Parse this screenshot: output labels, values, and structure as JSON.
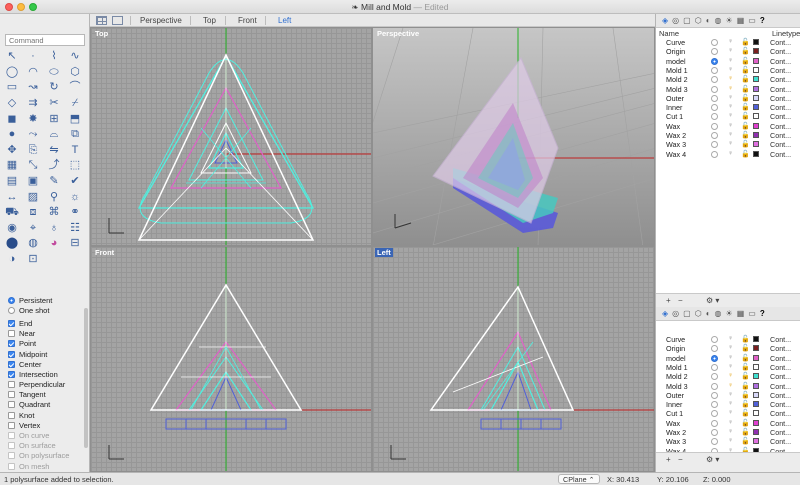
{
  "window": {
    "title": "Mill and Mold",
    "edited": "— Edited"
  },
  "viewport_tabs": [
    "Perspective",
    "Top",
    "Front",
    "Left"
  ],
  "command": {
    "placeholder": "Command"
  },
  "osnap": {
    "modes": [
      {
        "label": "Persistent",
        "selected": true
      },
      {
        "label": "One shot",
        "selected": false
      }
    ],
    "items": [
      {
        "label": "End",
        "checked": true,
        "enabled": true
      },
      {
        "label": "Near",
        "checked": false,
        "enabled": true
      },
      {
        "label": "Point",
        "checked": true,
        "enabled": true
      },
      {
        "label": "Midpoint",
        "checked": true,
        "enabled": true
      },
      {
        "label": "Center",
        "checked": true,
        "enabled": true
      },
      {
        "label": "Intersection",
        "checked": true,
        "enabled": true
      },
      {
        "label": "Perpendicular",
        "checked": false,
        "enabled": true
      },
      {
        "label": "Tangent",
        "checked": false,
        "enabled": true
      },
      {
        "label": "Quadrant",
        "checked": false,
        "enabled": true
      },
      {
        "label": "Knot",
        "checked": false,
        "enabled": true
      },
      {
        "label": "Vertex",
        "checked": false,
        "enabled": true
      },
      {
        "label": "On curve",
        "checked": false,
        "enabled": false
      },
      {
        "label": "On surface",
        "checked": false,
        "enabled": false
      },
      {
        "label": "On polysurface",
        "checked": false,
        "enabled": false
      },
      {
        "label": "On mesh",
        "checked": false,
        "enabled": false
      }
    ]
  },
  "viewports": {
    "top": {
      "label": "Top",
      "active": false
    },
    "perspective": {
      "label": "Perspective",
      "active": false
    },
    "front": {
      "label": "Front",
      "active": false
    },
    "left": {
      "label": "Left",
      "active": true
    }
  },
  "layers": {
    "header": {
      "name": "Name",
      "linetype": "Linetype"
    },
    "rows": [
      {
        "name": "Curve",
        "color": "#111111",
        "current": false,
        "on": false,
        "linetype": "Cont..."
      },
      {
        "name": "Origin",
        "color": "#7a1f1f",
        "current": false,
        "on": false,
        "linetype": "Cont..."
      },
      {
        "name": "model",
        "color": "#e060c8",
        "current": true,
        "on": false,
        "linetype": "Cont..."
      },
      {
        "name": "Mold 1",
        "color": "#ffffff",
        "current": false,
        "on": false,
        "linetype": "Cont..."
      },
      {
        "name": "Mold 2",
        "color": "#40e0d0",
        "current": false,
        "on": true,
        "linetype": "Cont..."
      },
      {
        "name": "Mold 3",
        "color": "#b070e0",
        "current": false,
        "on": true,
        "linetype": "Cont..."
      },
      {
        "name": "Outer",
        "color": "#d8d8f8",
        "current": false,
        "on": false,
        "linetype": "Cont..."
      },
      {
        "name": "Inner",
        "color": "#5060d8",
        "current": false,
        "on": false,
        "linetype": "Cont..."
      },
      {
        "name": "Cut 1",
        "color": "#ffffff",
        "current": false,
        "on": false,
        "linetype": "Cont..."
      },
      {
        "name": "Wax",
        "color": "#e040d0",
        "current": false,
        "on": false,
        "linetype": "Cont..."
      },
      {
        "name": "Wax 2",
        "color": "#9030b0",
        "current": false,
        "on": false,
        "linetype": "Cont..."
      },
      {
        "name": "Wax 3",
        "color": "#e070e0",
        "current": false,
        "on": false,
        "linetype": "Cont..."
      },
      {
        "name": "Wax 4",
        "color": "#111111",
        "current": false,
        "on": false,
        "linetype": "Cont..."
      }
    ]
  },
  "panel_buttons": {
    "add": "+",
    "remove": "−",
    "gear": "⚙ ▾"
  },
  "status": {
    "message": "1 polysurface added to selection.",
    "cplane": "CPlane ⌃",
    "x": "X: 30.413",
    "y": "Y: 20.106",
    "z": "Z: 0.000"
  }
}
